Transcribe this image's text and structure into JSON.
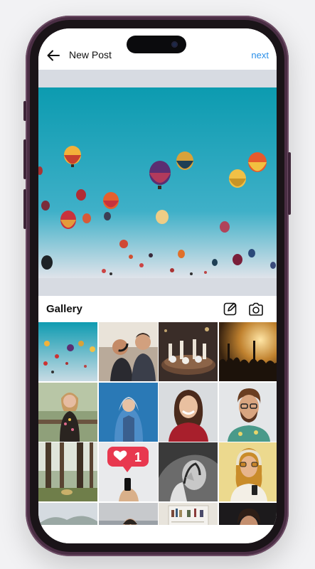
{
  "header": {
    "title": "New Post",
    "next_label": "next",
    "back_icon": "arrow-left-icon"
  },
  "gallery": {
    "title": "Gallery",
    "edit_icon": "edit-icon",
    "camera_icon": "camera-icon"
  },
  "notification_badge": {
    "count": "1",
    "icon": "heart-icon"
  },
  "colors": {
    "accent": "#2a8fe8",
    "sky": "#1f9bb3",
    "badge": "#e8384f"
  }
}
